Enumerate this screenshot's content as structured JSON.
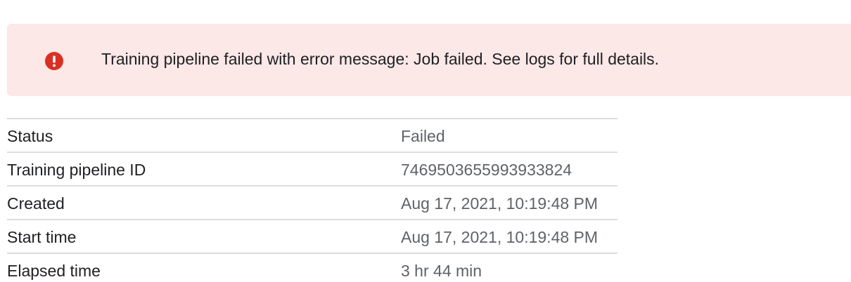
{
  "error_banner": {
    "icon": "error-icon",
    "icon_color": "#d93025",
    "background": "#fbe8e7",
    "message": "Training pipeline failed with error message: Job failed. See logs for full details."
  },
  "details": {
    "rows": [
      {
        "label": "Status",
        "value": "Failed"
      },
      {
        "label": "Training pipeline ID",
        "value": "7469503655993933824"
      },
      {
        "label": "Created",
        "value": "Aug 17, 2021, 10:19:48 PM"
      },
      {
        "label": "Start time",
        "value": "Aug 17, 2021, 10:19:48 PM"
      },
      {
        "label": "Elapsed time",
        "value": "3 hr 44 min"
      }
    ]
  }
}
